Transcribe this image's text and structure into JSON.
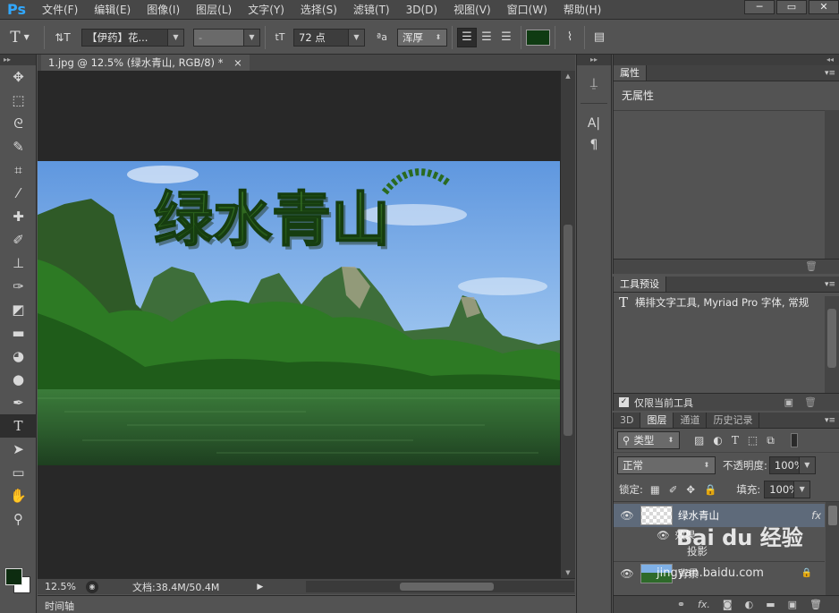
{
  "app": {
    "logo": "Ps"
  },
  "menu": [
    "文件(F)",
    "编辑(E)",
    "图像(I)",
    "图层(L)",
    "文字(Y)",
    "选择(S)",
    "滤镜(T)",
    "3D(D)",
    "视图(V)",
    "窗口(W)",
    "帮助(H)"
  ],
  "window_controls": {
    "minimize": "─",
    "restore": "▭",
    "close": "✕"
  },
  "options": {
    "tool_glyph": "T",
    "orient_glyph": "⇅T",
    "font_family": "【伊药】花...",
    "font_style": "-",
    "size_glyph": "tT",
    "font_size": "72 点",
    "aa_glyph": "ªa",
    "antialias": "浑厚",
    "text_color": "#0f3b12"
  },
  "toolbar": {
    "tools": [
      {
        "name": "move-tool-icon",
        "glyph": "✥"
      },
      {
        "name": "marquee-tool-icon",
        "glyph": "⬚"
      },
      {
        "name": "lasso-tool-icon",
        "glyph": "ᘓ"
      },
      {
        "name": "quick-select-tool-icon",
        "glyph": "✎"
      },
      {
        "name": "crop-tool-icon",
        "glyph": "⌗"
      },
      {
        "name": "eyedropper-tool-icon",
        "glyph": "⁄"
      },
      {
        "name": "healing-brush-tool-icon",
        "glyph": "✚"
      },
      {
        "name": "brush-tool-icon",
        "glyph": "✐"
      },
      {
        "name": "clone-stamp-tool-icon",
        "glyph": "⊥"
      },
      {
        "name": "history-brush-tool-icon",
        "glyph": "✑"
      },
      {
        "name": "eraser-tool-icon",
        "glyph": "◩"
      },
      {
        "name": "gradient-tool-icon",
        "glyph": "▬"
      },
      {
        "name": "blur-tool-icon",
        "glyph": "◕"
      },
      {
        "name": "dodge-tool-icon",
        "glyph": "●"
      },
      {
        "name": "pen-tool-icon",
        "glyph": "✒"
      },
      {
        "name": "type-tool-icon",
        "glyph": "T"
      },
      {
        "name": "path-select-tool-icon",
        "glyph": "➤"
      },
      {
        "name": "shape-tool-icon",
        "glyph": "▭"
      },
      {
        "name": "hand-tool-icon",
        "glyph": "✋"
      },
      {
        "name": "zoom-tool-icon",
        "glyph": "⚲"
      }
    ],
    "foreground_color": "#0d2c10",
    "background_color": "#ffffff"
  },
  "document": {
    "tab_title": "1.jpg @ 12.5% (绿水青山, RGB/8) *",
    "tab_close": "×",
    "image_text": "绿水青山",
    "zoom": "12.5%",
    "doc_info": "文档:38.4M/50.4M"
  },
  "timeline": {
    "label": "时间轴"
  },
  "properties": {
    "tab": "属性",
    "content": "无属性"
  },
  "tool_presets": {
    "tab": "工具预设",
    "preset_item": "横排文字工具, Myriad Pro 字体, 常规",
    "only_current_label": "仅限当前工具"
  },
  "layers": {
    "tabs": [
      "3D",
      "图层",
      "通道",
      "历史记录"
    ],
    "active_tab": "图层",
    "filter_kind": "类型",
    "blend_mode": "正常",
    "opacity_label": "不透明度:",
    "opacity_value": "100%",
    "lock_label": "锁定:",
    "fill_label": "填充:",
    "fill_value": "100%",
    "items": [
      {
        "name": "绿水青山",
        "fx": "fx"
      },
      {
        "name": "效果"
      },
      {
        "name": "投影"
      },
      {
        "name": "背景"
      }
    ]
  },
  "watermark": {
    "brand": "Bai du 经验",
    "url": "jingyan.baidu.com"
  }
}
